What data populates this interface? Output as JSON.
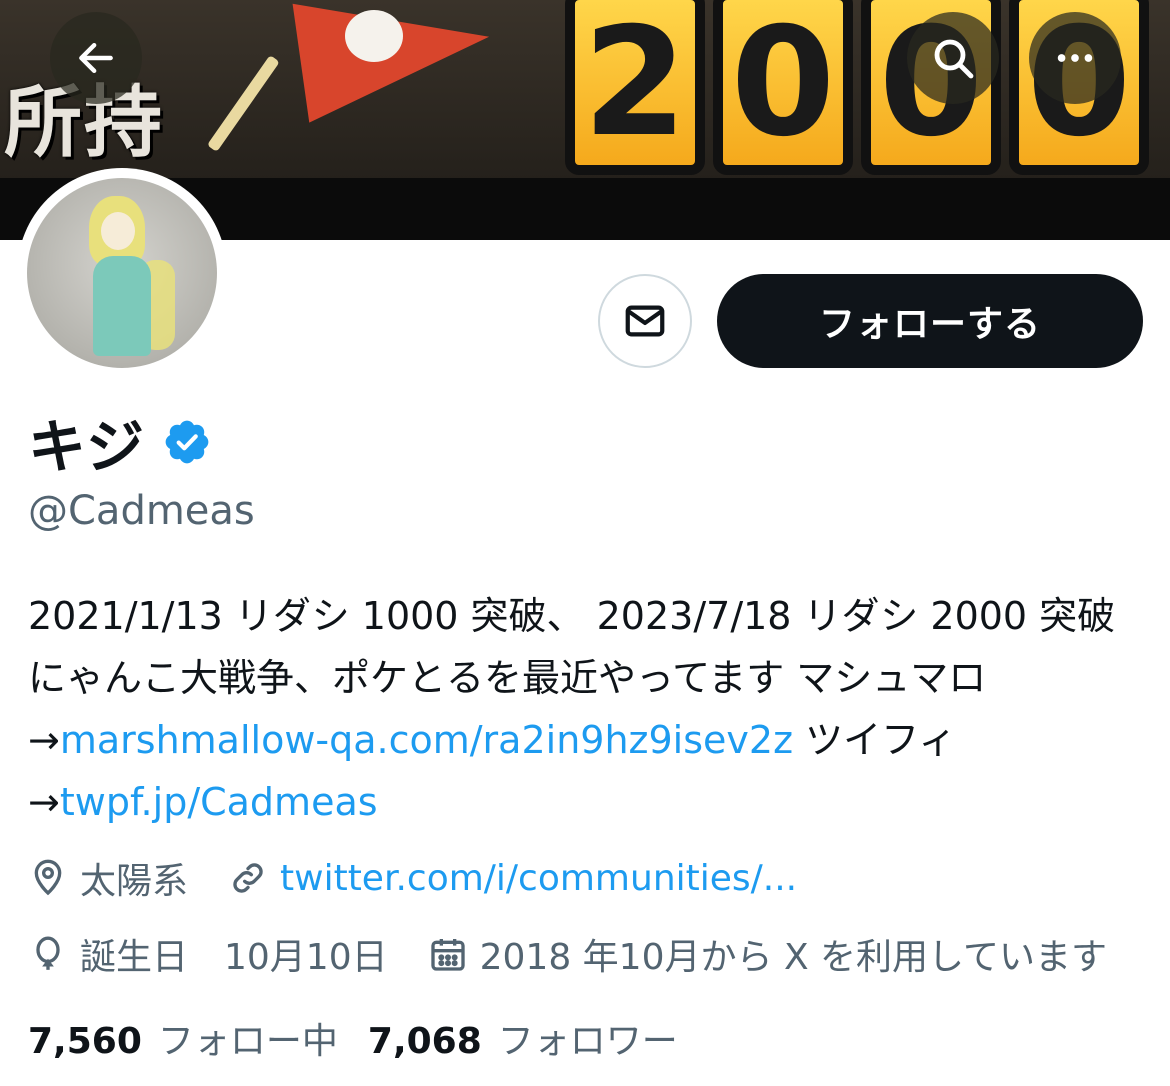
{
  "header": {
    "banner": {
      "text_left": "所持",
      "digits": [
        "2",
        "0",
        "0",
        "0"
      ],
      "colors": {
        "flag": "#d8452c",
        "digits": "#f5b52a",
        "background": "#2a2520"
      }
    },
    "buttons": {
      "back_icon": "arrow-left-icon",
      "search_icon": "search-icon",
      "more_icon": "more-icon"
    }
  },
  "profile": {
    "display_name": "キジ",
    "verified_icon": "verified-badge-icon",
    "handle": "@Cadmeas",
    "follow_label": "フォローする",
    "message_icon": "envelope-icon",
    "bio": {
      "part1": "2021/1/13 リダシ 1000 突破、 2023/7/18 リダシ 2000 突破 にゃんこ大戦争、ポケとるを最近やってます マシュマロ →",
      "link1": "marshmallow-qa.com/ra2in9hz9isev2z",
      "part2": " ツイフィ →",
      "link2": "twpf.jp/Cadmeas"
    },
    "meta": {
      "location": "太陽系",
      "website": "twitter.com/i/communities/...",
      "birthday": "誕生日　10月10日",
      "joined": "2018 年10月から X を利用しています"
    },
    "stats": {
      "following_count": "7,560",
      "following_label": "フォロー中",
      "followers_count": "7,068",
      "followers_label": "フォロワー"
    }
  },
  "colors": {
    "accent": "#1d9bf0",
    "text": "#0f1419",
    "secondary": "#536471",
    "follow_button": "#0f1419"
  }
}
